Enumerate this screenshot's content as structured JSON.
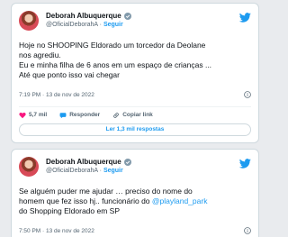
{
  "tweets": [
    {
      "author_name": "Deborah Albuquerque",
      "handle": "@OficialDeborahA",
      "separator": " · ",
      "follow_label": "Seguir",
      "lines": [
        "Hoje no SHOOPING Eldorado um torcedor da Deolane",
        "nos agrediu.",
        "Eu e minha filha de 6 anos em um espaço de crianças ...",
        "Até que ponto isso vai chegar"
      ],
      "timestamp": "7:19 PM · 13 de nov de 2022",
      "likes": "5,7 mil",
      "reply_label": "Responder",
      "copy_label": "Copiar link",
      "read_replies_label": "Ler 1,3 mil respostas"
    },
    {
      "author_name": "Deborah Albuquerque",
      "handle": "@OficialDeborahA",
      "separator": " · ",
      "follow_label": "Seguir",
      "line1": "Se alguém puder me ajudar … preciso do nome do",
      "line2_prefix": "homem que fez isso hj.. funcionário do ",
      "line2_link": "@playland_park",
      "line3": "do Shopping Eldorado em SP",
      "timestamp": "7:50 PM · 13 de nov de 2022"
    }
  ],
  "colors": {
    "accent": "#1d9bf0",
    "like": "#f91880",
    "verified": "#829aab"
  },
  "icons": [
    "avatar",
    "verified-badge-icon",
    "twitter-bird-icon",
    "info-icon",
    "heart-icon",
    "reply-icon",
    "link-icon"
  ]
}
